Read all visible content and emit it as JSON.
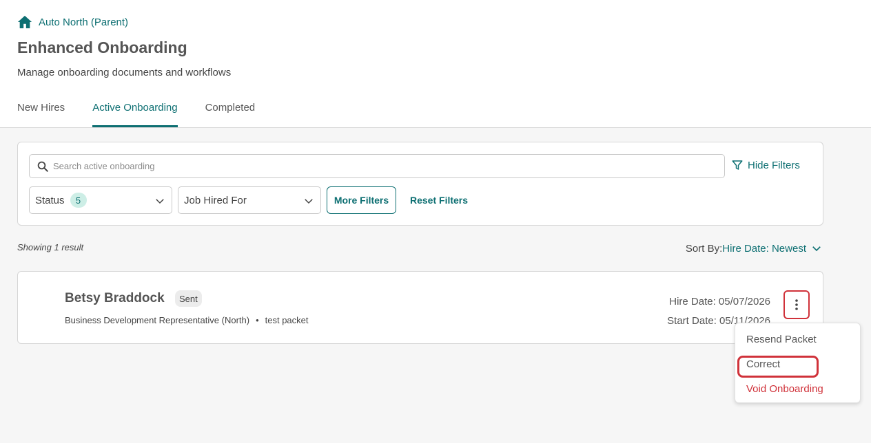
{
  "breadcrumb": {
    "label": "Auto North (Parent)",
    "icon": "home-icon"
  },
  "page": {
    "title": "Enhanced Onboarding",
    "subtitle": "Manage onboarding documents and workflows"
  },
  "tabs": [
    {
      "label": "New Hires",
      "active": false
    },
    {
      "label": "Active Onboarding",
      "active": true
    },
    {
      "label": "Completed",
      "active": false
    }
  ],
  "filters": {
    "search_placeholder": "Search active onboarding",
    "search_value": "",
    "hide_filters_label": "Hide Filters",
    "status_label": "Status",
    "status_count": "5",
    "job_label": "Job Hired For",
    "more_filters_label": "More Filters",
    "reset_filters_label": "Reset Filters"
  },
  "results": {
    "count_text": "Showing 1 result",
    "sort_label": "Sort By:",
    "sort_value": "Hire Date: Newest"
  },
  "record": {
    "name": "Betsy Braddock",
    "status": "Sent",
    "position": "Business Development Representative (North)",
    "separator": "•",
    "packet": "test packet",
    "hire_date": "Hire Date: 05/07/2026",
    "start_date": "Start Date: 05/11/2026"
  },
  "menu": {
    "items": [
      {
        "label": "Resend Packet"
      },
      {
        "label": "Correct"
      },
      {
        "label": "Void Onboarding"
      }
    ]
  },
  "colors": {
    "accent": "#0d6f72",
    "danger": "#d0323a",
    "badge_bg": "#cdeee6",
    "page_bg": "#f6f6f6"
  }
}
